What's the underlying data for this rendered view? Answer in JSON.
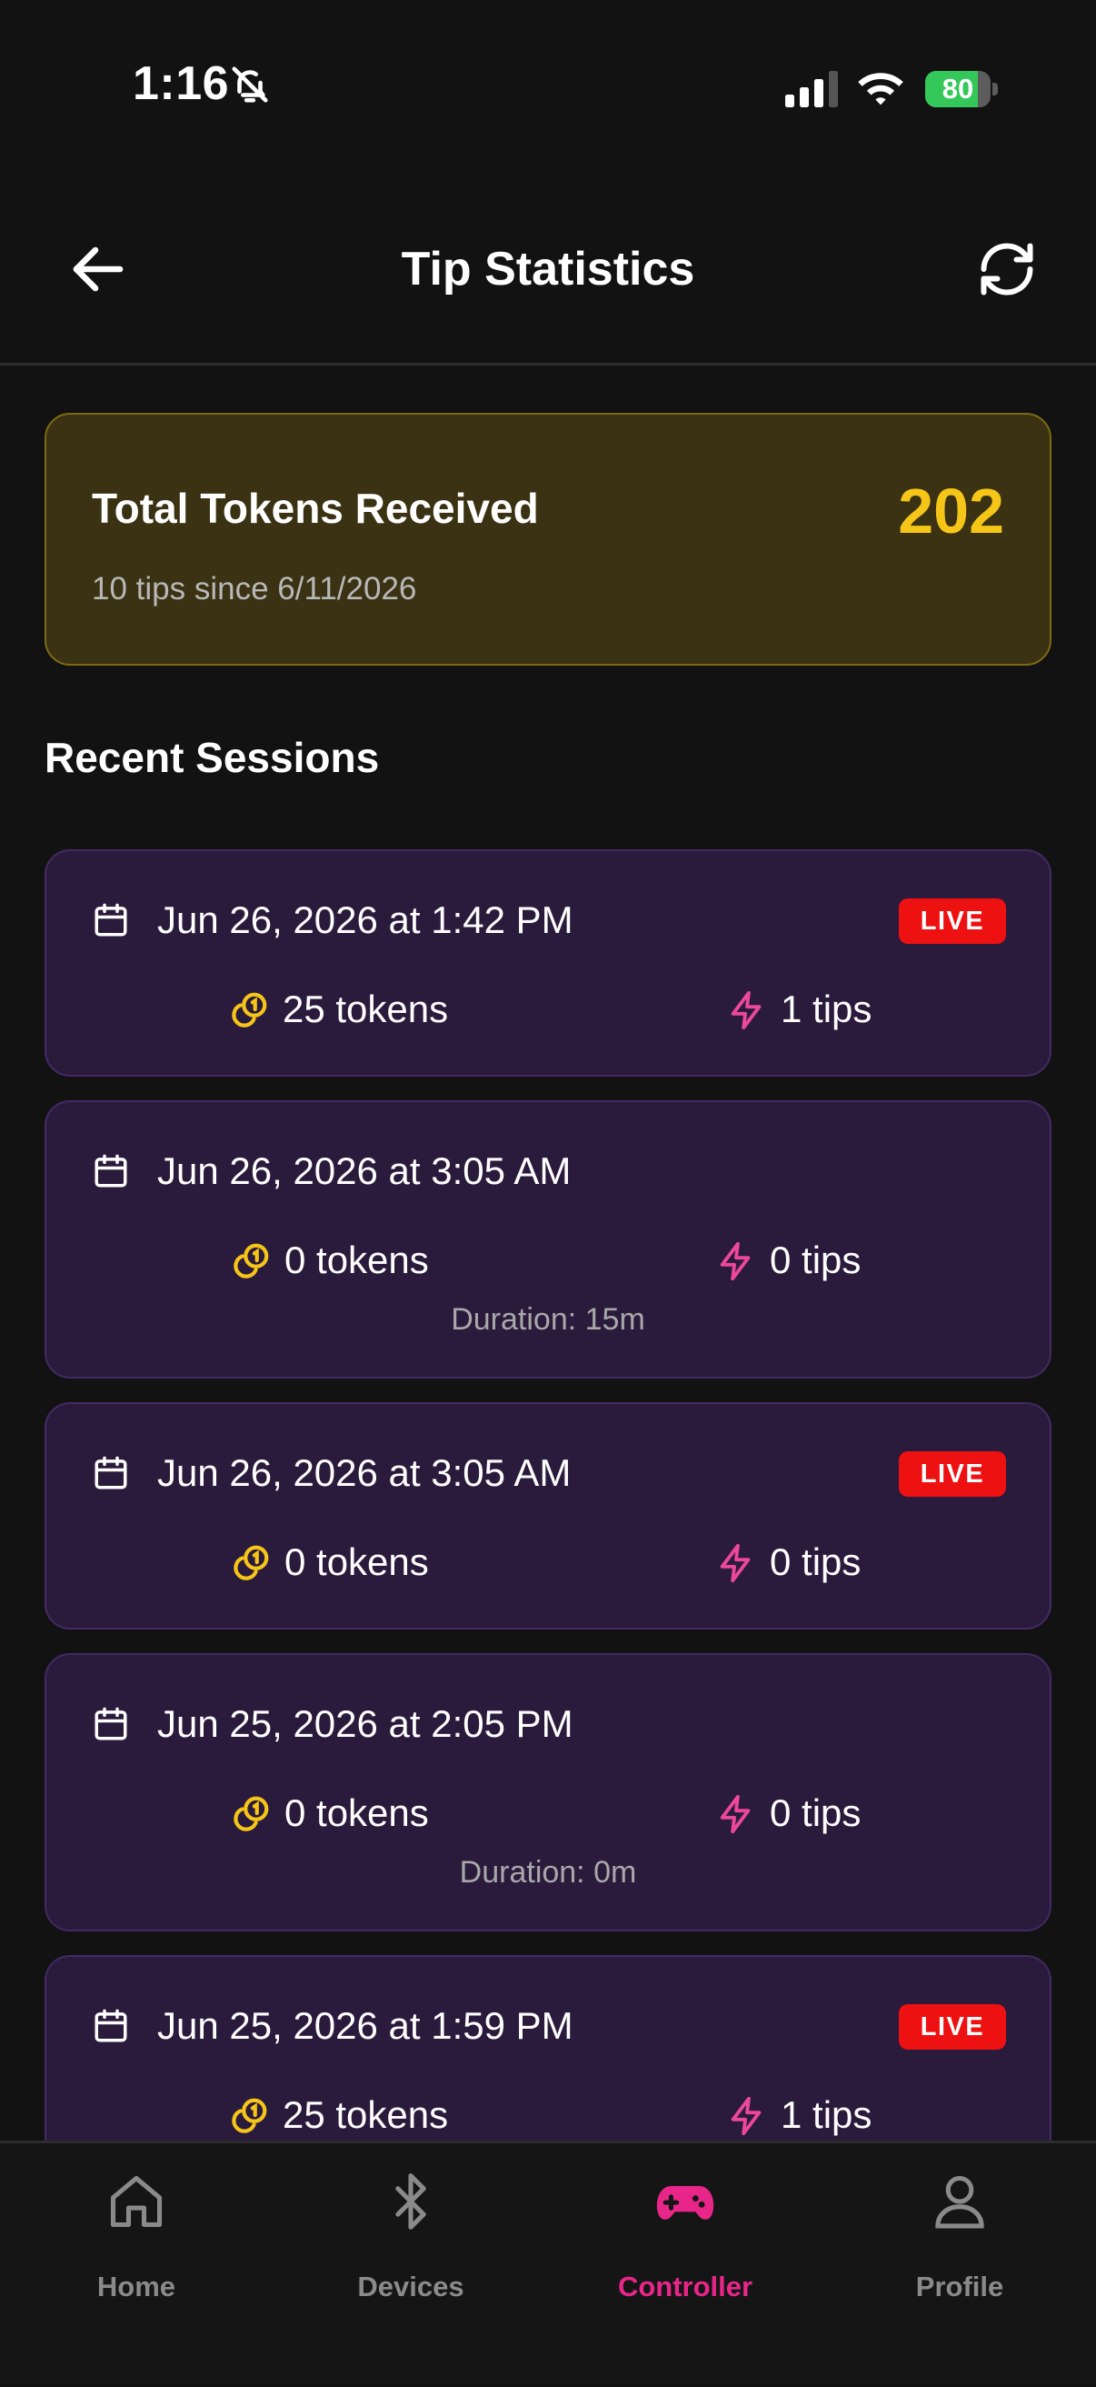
{
  "status_bar": {
    "time": "1:16",
    "battery_level": 80,
    "battery_text": "80"
  },
  "header": {
    "title": "Tip Statistics"
  },
  "summary": {
    "label": "Total Tokens Received",
    "total": "202",
    "subtitle": "10 tips since 6/11/2026"
  },
  "recent": {
    "title": "Recent Sessions"
  },
  "sessions": [
    {
      "date": "Jun 26, 2026 at 1:42 PM",
      "badge": "LIVE",
      "tokens": "25 tokens",
      "tips": "1 tips"
    },
    {
      "date": "Jun 26, 2026 at 3:05 AM",
      "tokens": "0 tokens",
      "tips": "0 tips",
      "duration": "Duration: 15m"
    },
    {
      "date": "Jun 26, 2026 at 3:05 AM",
      "badge": "LIVE",
      "tokens": "0 tokens",
      "tips": "0 tips"
    },
    {
      "date": "Jun 25, 2026 at 2:05 PM",
      "tokens": "0 tokens",
      "tips": "0 tips",
      "duration": "Duration: 0m"
    },
    {
      "date": "Jun 25, 2026 at 1:59 PM",
      "badge": "LIVE",
      "tokens": "25 tokens",
      "tips": "1 tips"
    }
  ],
  "tabs": [
    {
      "label": "Home",
      "icon": "home-icon",
      "active": false
    },
    {
      "label": "Devices",
      "icon": "bluetooth-icon",
      "active": false
    },
    {
      "label": "Controller",
      "icon": "gamepad-icon",
      "active": true
    },
    {
      "label": "Profile",
      "icon": "user-icon",
      "active": false
    }
  ],
  "colors": {
    "background": "#121212",
    "accent": "#e8268a",
    "gold": "#f5c518",
    "live": "#ee1111",
    "card": "#2a1a3c",
    "summary_card": "#3a3213"
  }
}
